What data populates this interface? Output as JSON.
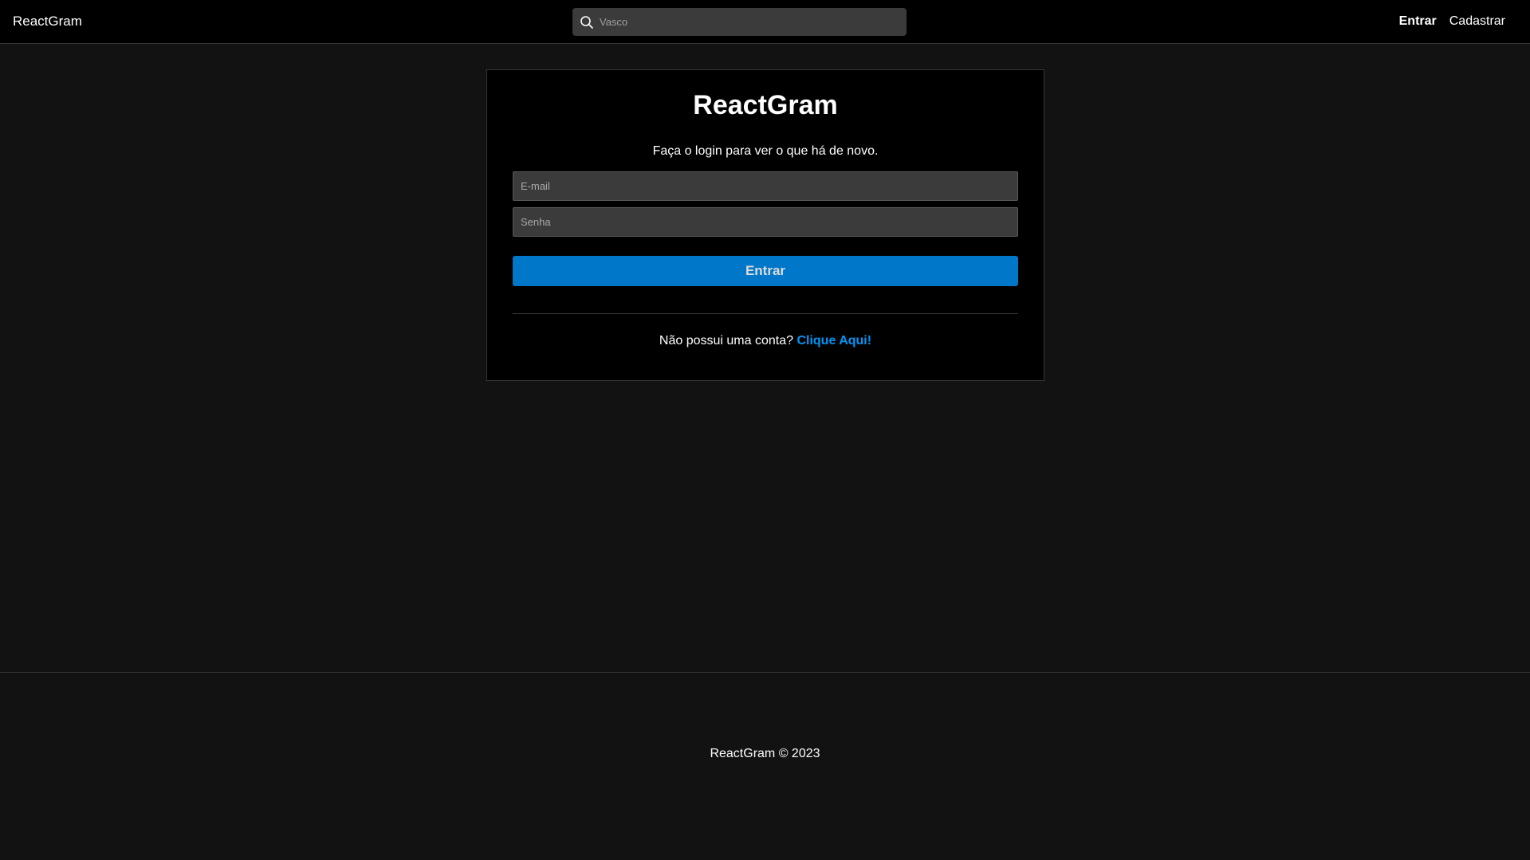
{
  "navbar": {
    "brand": "ReactGram",
    "search": {
      "placeholder": "Vasco",
      "icon": "search-icon"
    },
    "links": {
      "login": "Entrar",
      "register": "Cadastrar"
    }
  },
  "login": {
    "title": "ReactGram",
    "subtitle": "Faça o login para ver o que há de novo.",
    "email_placeholder": "E-mail",
    "password_placeholder": "Senha",
    "submit_label": "Entrar",
    "no_account_text": "Não possui uma conta? ",
    "signup_link": "Clique Aqui!"
  },
  "footer": {
    "text": "ReactGram © 2023"
  },
  "colors": {
    "background": "#121212",
    "navbar": "#000000",
    "card": "#000000",
    "input": "#3b3b3b",
    "button": "#0077c8",
    "link": "#0095f6",
    "border": "#363636"
  }
}
